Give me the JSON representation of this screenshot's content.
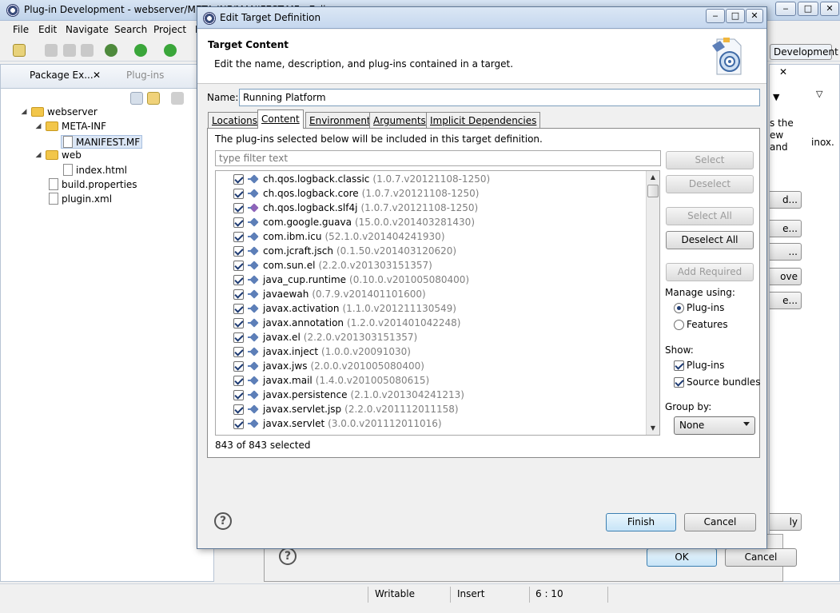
{
  "main": {
    "title": "Plug-in Development - webserver/META-INF/MANIFEST.MF - Eclipse",
    "menu": [
      "File",
      "Edit",
      "Navigate",
      "Search",
      "Project",
      "R"
    ],
    "left_tabs": [
      "Package Ex...",
      "Plug-ins"
    ],
    "tree": [
      {
        "label": "webserver",
        "kind": "folder",
        "depth": 0
      },
      {
        "label": "META-INF",
        "kind": "folder",
        "depth": 1
      },
      {
        "label": "MANIFEST.MF",
        "kind": "file",
        "depth": 2
      },
      {
        "label": "web",
        "kind": "folder",
        "depth": 1
      },
      {
        "label": "index.html",
        "kind": "file",
        "depth": 2
      },
      {
        "label": "build.properties",
        "kind": "file",
        "depth": 1
      },
      {
        "label": "plugin.xml",
        "kind": "file",
        "depth": 1
      }
    ],
    "perspective": "Development",
    "right_snippets": [
      "s the",
      "ew",
      "and",
      "inox."
    ],
    "right_buttons": [
      "d...",
      "e...",
      "...",
      "ove",
      "e..."
    ],
    "status": {
      "mode": "Writable",
      "insert": "Insert",
      "position": "6 : 10"
    }
  },
  "pref_dialog": {
    "ok_label": "OK",
    "cancel_label": "Cancel",
    "apply_fragment": "ly"
  },
  "dialog": {
    "title": "Edit Target Definition",
    "header_title": "Target Content",
    "header_desc": "Edit the name, description, and plug-ins contained in a target.",
    "name_label": "Name:",
    "name_value": "Running Platform",
    "tabs": [
      "Locations",
      "Content",
      "Environment",
      "Arguments",
      "Implicit Dependencies"
    ],
    "active_tab": "Content",
    "content_desc": "The plug-ins selected below will be included in this target definition.",
    "filter_placeholder": "type filter text",
    "plugins": [
      {
        "id": "ch.qos.logback.classic",
        "version": "(1.0.7.v20121108-1250)"
      },
      {
        "id": "ch.qos.logback.core",
        "version": "(1.0.7.v20121108-1250)"
      },
      {
        "id": "ch.qos.logback.slf4j",
        "version": "(1.0.7.v20121108-1250)"
      },
      {
        "id": "com.google.guava",
        "version": "(15.0.0.v201403281430)"
      },
      {
        "id": "com.ibm.icu",
        "version": "(52.1.0.v201404241930)"
      },
      {
        "id": "com.jcraft.jsch",
        "version": "(0.1.50.v201403120620)"
      },
      {
        "id": "com.sun.el",
        "version": "(2.2.0.v201303151357)"
      },
      {
        "id": "java_cup.runtime",
        "version": "(0.10.0.v201005080400)"
      },
      {
        "id": "javaewah",
        "version": "(0.7.9.v201401101600)"
      },
      {
        "id": "javax.activation",
        "version": "(1.1.0.v201211130549)"
      },
      {
        "id": "javax.annotation",
        "version": "(1.2.0.v201401042248)"
      },
      {
        "id": "javax.el",
        "version": "(2.2.0.v201303151357)"
      },
      {
        "id": "javax.inject",
        "version": "(1.0.0.v20091030)"
      },
      {
        "id": "javax.jws",
        "version": "(2.0.0.v201005080400)"
      },
      {
        "id": "javax.mail",
        "version": "(1.4.0.v201005080615)"
      },
      {
        "id": "javax.persistence",
        "version": "(2.1.0.v201304241213)"
      },
      {
        "id": "javax.servlet.jsp",
        "version": "(2.2.0.v201112011158)"
      },
      {
        "id": "javax.servlet",
        "version": "(3.0.0.v201112011016)"
      }
    ],
    "selection_count": "843 of 843 selected",
    "buttons": {
      "select": "Select",
      "deselect": "Deselect",
      "select_all": "Select All",
      "deselect_all": "Deselect All",
      "add_required": "Add Required"
    },
    "manage_label": "Manage using:",
    "manage_options": [
      "Plug-ins",
      "Features"
    ],
    "manage_selected": "Plug-ins",
    "show_label": "Show:",
    "show_options": [
      "Plug-ins",
      "Source bundles"
    ],
    "group_label": "Group by:",
    "group_value": "None",
    "finish_label": "Finish",
    "cancel_label": "Cancel"
  }
}
